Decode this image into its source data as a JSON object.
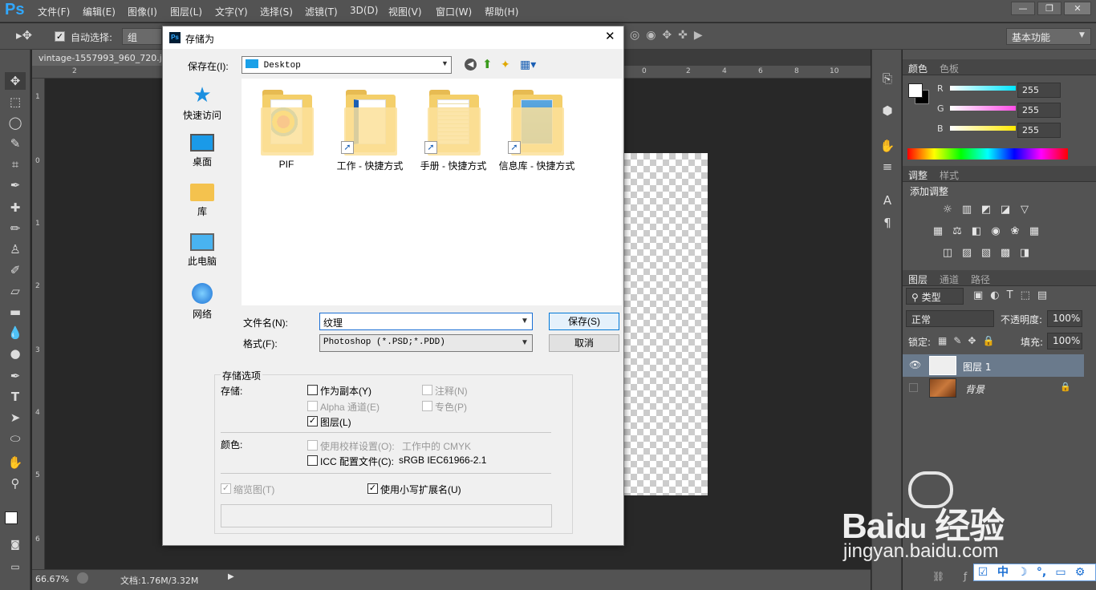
{
  "app": {
    "logo": "Ps",
    "menu": [
      "文件(F)",
      "编辑(E)",
      "图像(I)",
      "图层(L)",
      "文字(Y)",
      "选择(S)",
      "滤镜(T)",
      "3D(D)",
      "视图(V)",
      "窗口(W)",
      "帮助(H)"
    ],
    "window_controls": [
      "—",
      "❐",
      "✕"
    ]
  },
  "options_bar": {
    "auto_select_label": "自动选择:",
    "auto_select_value": "组",
    "workspace": "基本功能"
  },
  "document": {
    "tab_title": "vintage-1557993_960_720.j",
    "ruler_h_ticks": [
      "2",
      "0",
      "2",
      "4",
      "6",
      "8",
      "10"
    ],
    "ruler_v_ticks": [
      "1",
      "0",
      "1",
      "2",
      "3",
      "4",
      "5",
      "6"
    ],
    "zoom": "66.67%",
    "doc_info": "文档:1.76M/3.32M"
  },
  "color_panel": {
    "tabs": [
      "颜色",
      "色板"
    ],
    "channels": [
      {
        "label": "R",
        "value": "255",
        "color": "#00e5ff"
      },
      {
        "label": "G",
        "value": "255",
        "color": "#ff4de6"
      },
      {
        "label": "B",
        "value": "255",
        "color": "#ffe800"
      }
    ]
  },
  "adjust_panel": {
    "tabs": [
      "调整",
      "样式"
    ],
    "title": "添加调整"
  },
  "layers_panel": {
    "tabs": [
      "图层",
      "通道",
      "路径"
    ],
    "filter_kind": "类型",
    "blend_mode": "正常",
    "opacity_label": "不透明度:",
    "opacity_value": "100%",
    "lock_label": "锁定:",
    "fill_label": "填充:",
    "fill_value": "100%",
    "layers": [
      {
        "name": "图层 1",
        "visible": true,
        "selected": true
      },
      {
        "name": "背景",
        "visible": false,
        "selected": false,
        "locked": true
      }
    ]
  },
  "dialog": {
    "title": "存储为",
    "save_in_label": "保存在(I):",
    "save_in_value": "Desktop",
    "nav": [
      "快速访问",
      "桌面",
      "库",
      "此电脑",
      "网络"
    ],
    "files": [
      "PIF",
      "工作 - 快捷方式",
      "手册 - 快捷方式",
      "信息库 - 快捷方式"
    ],
    "filename_label": "文件名(N):",
    "filename_value": "纹理",
    "format_label": "格式(F):",
    "format_value": "Photoshop (*.PSD;*.PDD)",
    "save_button": "保存(S)",
    "cancel_button": "取消",
    "options_title": "存储选项",
    "store_label": "存储:",
    "store_options": [
      {
        "label": "作为副本(Y)",
        "checked": false,
        "disabled": false
      },
      {
        "label": "注释(N)",
        "checked": false,
        "disabled": true
      },
      {
        "label": "Alpha 通道(E)",
        "checked": false,
        "disabled": true
      },
      {
        "label": "专色(P)",
        "checked": false,
        "disabled": true
      },
      {
        "label": "图层(L)",
        "checked": true,
        "disabled": false
      }
    ],
    "color_label": "颜色:",
    "proof_label": "使用校样设置(O):",
    "proof_value": "工作中的 CMYK",
    "icc_label": "ICC 配置文件(C):",
    "icc_value": "sRGB IEC61966-2.1",
    "thumbnail_label": "缩览图(T)",
    "lowercase_label": "使用小写扩展名(U)"
  },
  "watermark": {
    "brand": "Bai",
    "brand_du": "du",
    "brand_cn": "经验",
    "url": "jingyan.baidu.com"
  },
  "ime": {
    "lang": "中"
  }
}
